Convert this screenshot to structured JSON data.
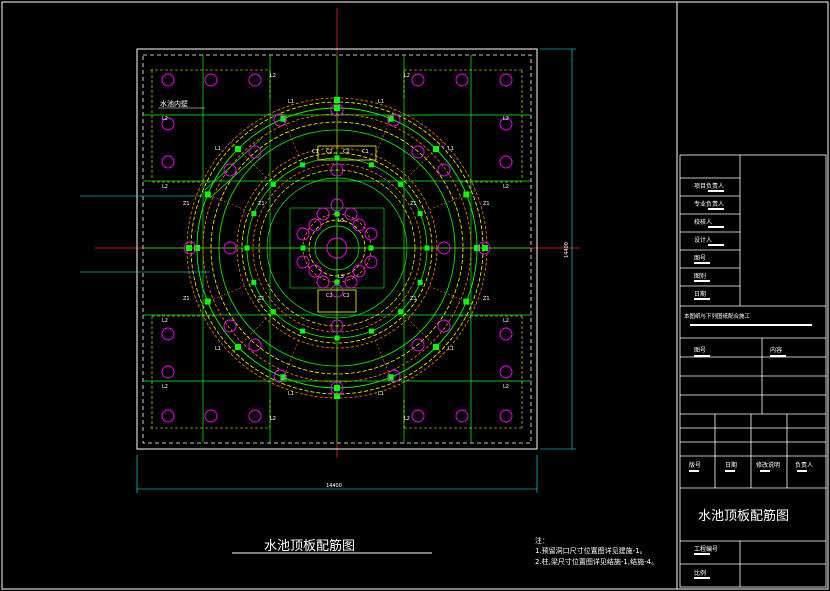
{
  "drawing": {
    "title": "水池顶板配筋图",
    "dim_bottom": "14400",
    "dim_right": "14400",
    "labels": {
      "inner_wall": "水池内壁",
      "c1": "C1",
      "c2": "C2",
      "c3": "C3",
      "l1": "L1",
      "l2": "L2",
      "l3": "L3",
      "z1": "Z1",
      "l4": "L4"
    },
    "notes_heading": "注：",
    "notes": [
      "1.预留洞口尺寸位置图详见建施-1。",
      "2.柱,梁尺寸位置图详见结施-1,结施-4。"
    ]
  },
  "title_block": {
    "rows": [
      {
        "label": "项目负责人"
      },
      {
        "label": "专业负责人"
      },
      {
        "label": "校核人"
      },
      {
        "label": "设计人"
      },
      {
        "label": "图号"
      },
      {
        "label": "图别"
      },
      {
        "label": "日期"
      }
    ],
    "note": "本图纸与下列图纸配合施工",
    "table_head": [
      "图号",
      "内容"
    ],
    "sign_row": [
      "版号",
      "日期",
      "修改说明",
      "负责人"
    ],
    "drawing_name": "水池顶板配筋图",
    "project_no": "工程编号",
    "scale": "比例"
  },
  "colors": {
    "background": "#000000",
    "frame": "#ffffff",
    "beam": "#ffff00",
    "rebar": "#ff7f00",
    "grid": "#00ff00",
    "column": "#00ff00",
    "hole": "#ff00ff",
    "axis": "#ff0000",
    "dim": "#00ffff"
  }
}
